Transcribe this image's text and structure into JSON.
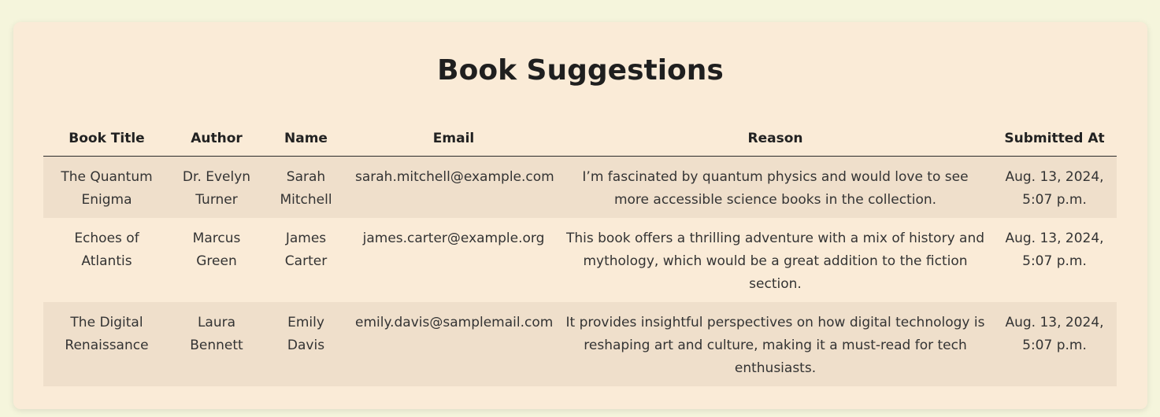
{
  "page": {
    "title": "Book Suggestions"
  },
  "table": {
    "headers": [
      "Book Title",
      "Author",
      "Name",
      "Email",
      "Reason",
      "Submitted At"
    ],
    "rows": [
      {
        "book_title": "The Quantum Enigma",
        "author": "Dr. Evelyn Turner",
        "name": "Sarah Mitchell",
        "email": "sarah.mitchell@example.com",
        "reason": "I’m fascinated by quantum physics and would love to see more accessible science books in the collection.",
        "submitted_at": "Aug. 13, 2024, 5:07 p.m."
      },
      {
        "book_title": "Echoes of Atlantis",
        "author": "Marcus Green",
        "name": "James Carter",
        "email": "james.carter@example.org",
        "reason": "This book offers a thrilling adventure with a mix of history and mythology, which would be a great addition to the fiction section.",
        "submitted_at": "Aug. 13, 2024, 5:07 p.m."
      },
      {
        "book_title": "The Digital Renaissance",
        "author": "Laura Bennett",
        "name": "Emily Davis",
        "email": "emily.davis@samplemail.com",
        "reason": "It provides insightful perspectives on how digital technology is reshaping art and culture, making it a must-read for tech enthusiasts.",
        "submitted_at": "Aug. 13, 2024, 5:07 p.m."
      }
    ]
  },
  "colors": {
    "page_background": "#f5f5dc",
    "card_background": "#faebd7",
    "striped_row": "#efdfcb",
    "header_border": "#2b2b2b"
  }
}
